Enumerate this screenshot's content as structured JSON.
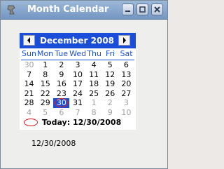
{
  "window": {
    "title": "Month Calendar",
    "icon": "app-icon"
  },
  "calendar": {
    "month_label": "December 2008",
    "weekdays": [
      "Sun",
      "Mon",
      "Tue",
      "Wed",
      "Thu",
      "Fri",
      "Sat"
    ],
    "weeks": [
      [
        {
          "d": "30",
          "m": true
        },
        {
          "d": "1"
        },
        {
          "d": "2"
        },
        {
          "d": "3"
        },
        {
          "d": "4"
        },
        {
          "d": "5"
        },
        {
          "d": "6"
        }
      ],
      [
        {
          "d": "7"
        },
        {
          "d": "8"
        },
        {
          "d": "9"
        },
        {
          "d": "10"
        },
        {
          "d": "11"
        },
        {
          "d": "12"
        },
        {
          "d": "13"
        }
      ],
      [
        {
          "d": "14"
        },
        {
          "d": "15"
        },
        {
          "d": "16"
        },
        {
          "d": "17"
        },
        {
          "d": "18"
        },
        {
          "d": "19"
        },
        {
          "d": "20"
        }
      ],
      [
        {
          "d": "21"
        },
        {
          "d": "22"
        },
        {
          "d": "23"
        },
        {
          "d": "24"
        },
        {
          "d": "25"
        },
        {
          "d": "26"
        },
        {
          "d": "27"
        }
      ],
      [
        {
          "d": "28"
        },
        {
          "d": "29"
        },
        {
          "d": "30",
          "sel": true,
          "today": true
        },
        {
          "d": "31"
        },
        {
          "d": "1",
          "m": true
        },
        {
          "d": "2",
          "m": true
        },
        {
          "d": "3",
          "m": true
        }
      ],
      [
        {
          "d": "4",
          "m": true
        },
        {
          "d": "5",
          "m": true
        },
        {
          "d": "6",
          "m": true
        },
        {
          "d": "7",
          "m": true
        },
        {
          "d": "8",
          "m": true
        },
        {
          "d": "9",
          "m": true
        },
        {
          "d": "10",
          "m": true
        }
      ]
    ],
    "today_label": "Today: 12/30/2008",
    "colors": {
      "header": "#1b4ed8",
      "today_ring": "#e02020",
      "muted": "#a0a0a0"
    }
  },
  "status_text": "12/30/2008"
}
